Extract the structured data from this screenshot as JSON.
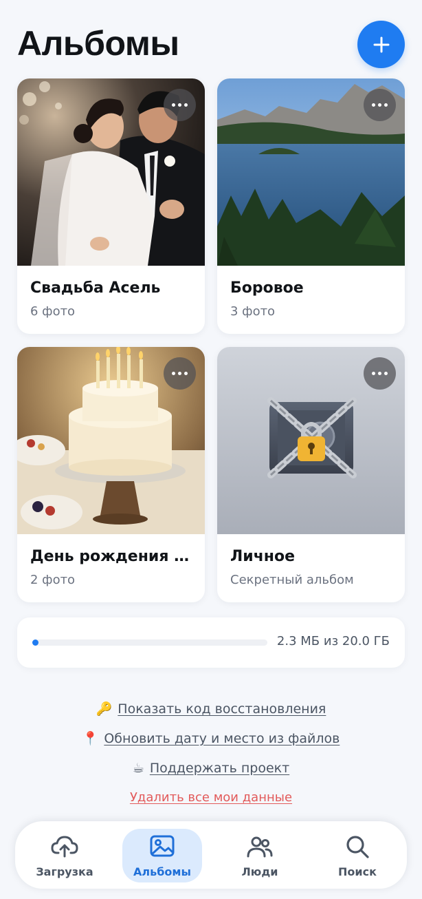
{
  "header": {
    "title": "Альбомы",
    "add_icon": "plus-icon"
  },
  "albums": [
    {
      "name": "Свадьба Асель",
      "count": "6 фото",
      "cover": "wedding-photo"
    },
    {
      "name": "Боровое",
      "count": "3 фото",
      "cover": "lake-mountains-photo"
    },
    {
      "name": "День рождения мамы",
      "count": "2 фото",
      "cover": "birthday-cake-photo"
    },
    {
      "name": "Личное",
      "count": "Секретный альбом",
      "cover": "locked-safe-icon"
    }
  ],
  "storage": {
    "text": "2.3 МБ из 20.0 ГБ",
    "used_fraction": 0.0001
  },
  "links": {
    "recovery": {
      "emoji": "🔑",
      "label": "Показать код восстановления"
    },
    "update_meta": {
      "emoji": "📍",
      "label": "Обновить дату и место из файлов"
    },
    "support": {
      "emoji": "☕",
      "label": "Поддержать проект"
    },
    "delete": "Удалить все мои данные"
  },
  "tabs": [
    {
      "label": "Загрузка",
      "icon": "cloud-upload-icon",
      "active": false
    },
    {
      "label": "Альбомы",
      "icon": "image-icon",
      "active": true
    },
    {
      "label": "Люди",
      "icon": "people-icon",
      "active": false
    },
    {
      "label": "Поиск",
      "icon": "search-icon",
      "active": false
    }
  ],
  "colors": {
    "accent": "#1f7cf1",
    "background": "#f5f7fb",
    "danger": "#e25a5a"
  }
}
